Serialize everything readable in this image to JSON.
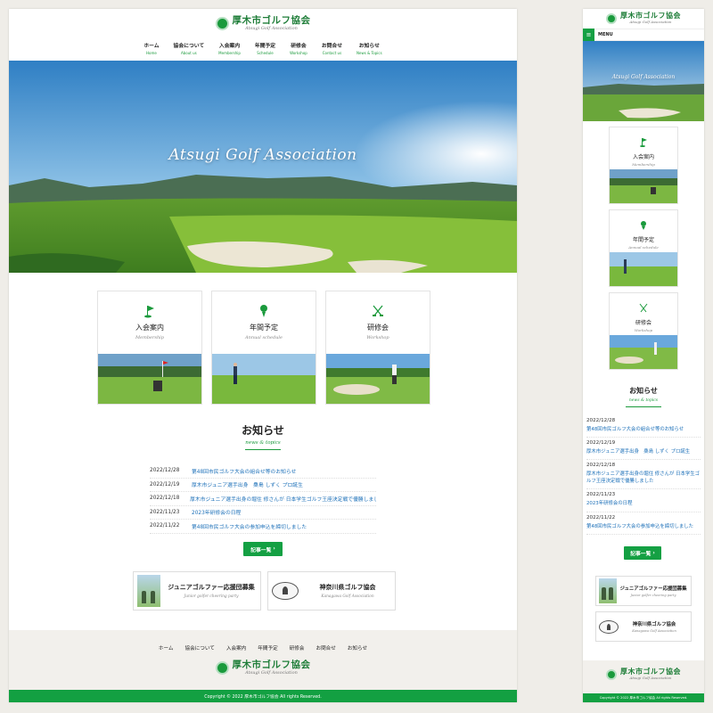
{
  "site": {
    "logo_jp": "厚木市ゴルフ協会",
    "logo_en": "Atsugi Golf Association"
  },
  "nav": [
    {
      "jp": "ホーム",
      "en": "Home"
    },
    {
      "jp": "協会について",
      "en": "About us"
    },
    {
      "jp": "入会案内",
      "en": "Membership"
    },
    {
      "jp": "年間予定",
      "en": "Schedule"
    },
    {
      "jp": "研修会",
      "en": "Workshop"
    },
    {
      "jp": "お問合せ",
      "en": "Contact us"
    },
    {
      "jp": "お知らせ",
      "en": "News & Topics"
    }
  ],
  "hero": {
    "title": "Atsugi Golf Association"
  },
  "cards": [
    {
      "title": "入会案内",
      "sub": "Membership",
      "icon": "golf-flag-icon"
    },
    {
      "title": "年間予定",
      "sub": "Annual schedule",
      "icon": "golf-tee-icon"
    },
    {
      "title": "研修会",
      "sub": "Workshop",
      "icon": "crossed-clubs-icon"
    }
  ],
  "news": {
    "heading": "お知らせ",
    "sub": "news & topics",
    "items": [
      {
        "date": "2022/12/28",
        "title": "第48回市民ゴルフ大会の組合せ等のお知らせ"
      },
      {
        "date": "2022/12/19",
        "title": "厚木市ジュニア選手出身　桑島 しずく プロ誕生"
      },
      {
        "date": "2022/12/18",
        "title": "厚木市ジュニア選手出身の堀住 修さんが 日本学生ゴルフ王座決定戦で優勝しました"
      },
      {
        "date": "2022/11/23",
        "title": "2023年研修会の日程"
      },
      {
        "date": "2022/11/22",
        "title": "第48回市民ゴルフ大会の参加申込を締切しました"
      }
    ],
    "more_label": "記事一覧"
  },
  "banners": [
    {
      "jp": "ジュニアゴルファー応援団募集",
      "en": "Junior golfer cheering party"
    },
    {
      "jp": "神奈川県ゴルフ協会",
      "en": "Kanagawa Golf Association"
    }
  ],
  "footer": {
    "nav": [
      "ホーム",
      "協会について",
      "入会案内",
      "年間予定",
      "研修会",
      "お問合せ",
      "お知らせ"
    ],
    "copyright": "Copyright © 2022 厚木市ゴルフ協会 All rights Reserved."
  },
  "mobile": {
    "menu_label": "MENU",
    "menu_icon": "hamburger-icon"
  },
  "colors": {
    "brand_green": "#14a043",
    "link_blue": "#1b6fb8",
    "footer_bg": "#f2f0ec"
  }
}
